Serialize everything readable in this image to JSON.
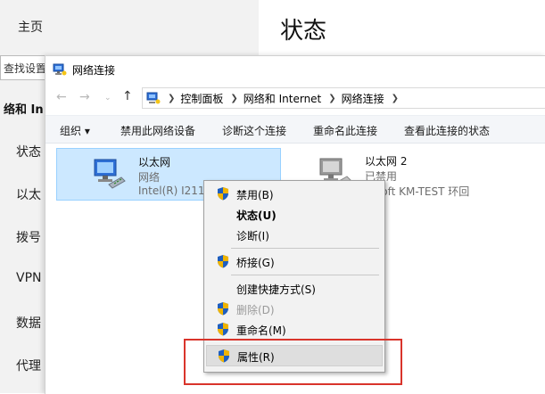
{
  "settings": {
    "home": "主页",
    "find": "查找设置",
    "section": "络和 In",
    "nav": [
      "状态",
      "以太",
      "拨号",
      "VPN",
      "数据",
      "代理"
    ],
    "status_title": "状态"
  },
  "window": {
    "title": "网络连接",
    "breadcrumb": [
      "控制面板",
      "网络和 Internet",
      "网络连接"
    ],
    "commands": [
      "组织 ▾",
      "禁用此网络设备",
      "诊断这个连接",
      "重命名此连接",
      "查看此连接的状态"
    ]
  },
  "connections": [
    {
      "name": "以太网",
      "status": "网络",
      "device": "Intel(R) I211"
    },
    {
      "name": "以太网 2",
      "status": "已禁用",
      "device": "rosoft KM-TEST 环回"
    }
  ],
  "context_menu": [
    {
      "label": "禁用(B)",
      "shield": true
    },
    {
      "label": "状态(U)",
      "bold": true
    },
    {
      "label": "诊断(I)"
    },
    {
      "label": "桥接(G)",
      "shield": true
    },
    {
      "label": "创建快捷方式(S)"
    },
    {
      "label": "删除(D)",
      "shield": true,
      "disabled": true
    },
    {
      "label": "重命名(M)",
      "shield": true
    },
    {
      "label": "属性(R)",
      "shield": true,
      "hover": true
    }
  ],
  "colors": {
    "selection": "#cce8ff",
    "highlight": "#d9342b",
    "shield_blue": "#1f5fbf",
    "shield_gold": "#f0b400"
  }
}
